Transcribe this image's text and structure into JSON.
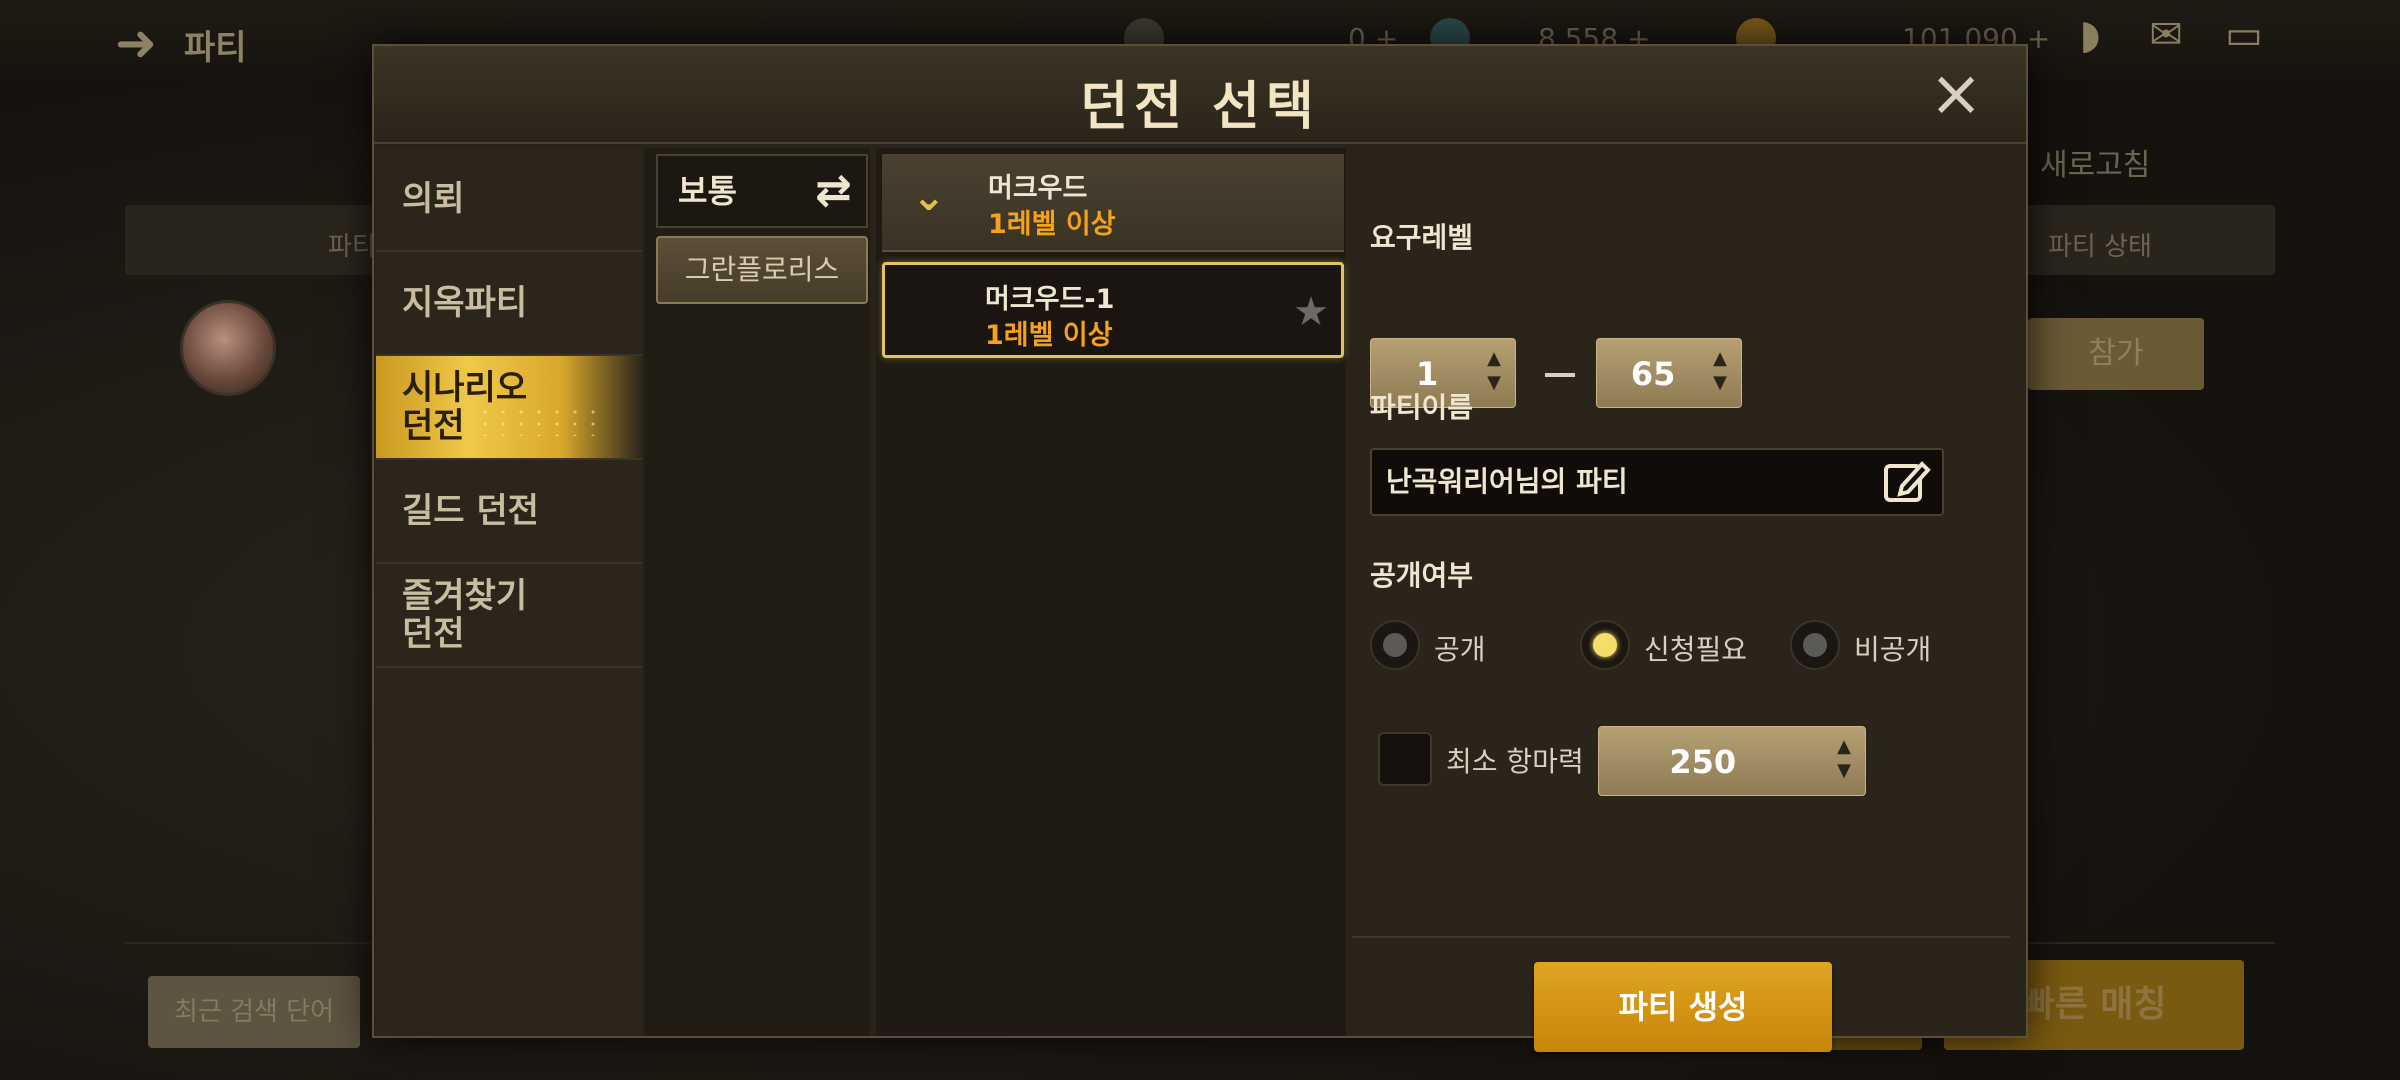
{
  "background": {
    "title": "파티",
    "currency": [
      "0 +",
      "8,558 +",
      "101,090 +"
    ],
    "refresh_label": "새로고침",
    "col_left": "파티",
    "col_status": "파티 상태",
    "join_label": "참가",
    "recent_search_label": "최근 검색 단어",
    "fast_match_label": "빠른 매칭"
  },
  "modal": {
    "title": "던전 선택",
    "categories": [
      {
        "label": "의뢰",
        "active": false
      },
      {
        "label": "지옥파티",
        "active": false
      },
      {
        "label": "시나리오\n던전",
        "active": true
      },
      {
        "label": "길드 던전",
        "active": false
      },
      {
        "label": "즐겨찾기\n던전",
        "active": false
      }
    ],
    "difficulty": "보통",
    "region": "그란플로리스",
    "dungeon_group": {
      "name": "머크우드",
      "level": "1레벨 이상"
    },
    "dungeon_items": [
      {
        "name": "머크우드-1",
        "level": "1레벨 이상",
        "selected": true
      }
    ],
    "settings": {
      "level_label": "요구레벨",
      "level_min": "1",
      "level_max": "65",
      "party_name_label": "파티이름",
      "party_name": "난곡워리어님의 파티",
      "visibility_label": "공개여부",
      "visibility_options": [
        "공개",
        "신청필요",
        "비공개"
      ],
      "visibility_selected": "신청필요",
      "min_power_label": "최소 항마력",
      "min_power": "250",
      "min_power_checked": false,
      "create_label": "파티 생성"
    }
  },
  "colors": {
    "accent": "#e0a322",
    "level_text": "#f4a21c",
    "selected_border": "#e2c262"
  }
}
